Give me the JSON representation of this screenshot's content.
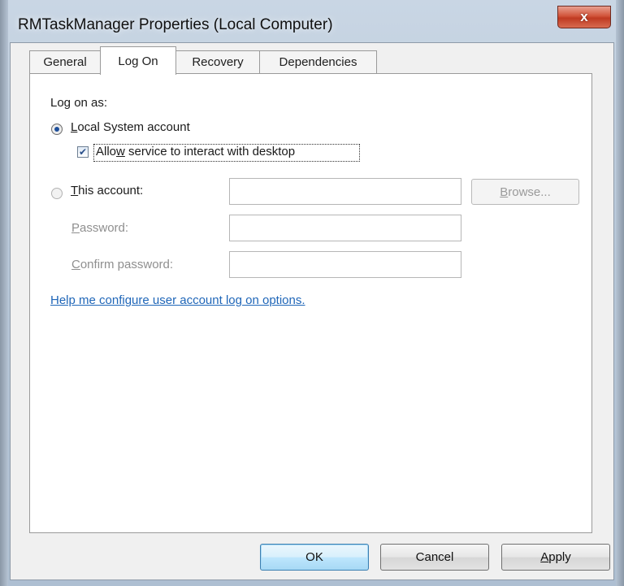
{
  "window": {
    "title": "RMTaskManager Properties (Local Computer)",
    "close_glyph": "x"
  },
  "tabs": [
    {
      "label": "General",
      "active": false
    },
    {
      "label": "Log On",
      "active": true
    },
    {
      "label": "Recovery",
      "active": false
    },
    {
      "label": "Dependencies",
      "active": false
    }
  ],
  "logon": {
    "section_label": "Log on as:",
    "local_system": {
      "mnemonic": "L",
      "rest": "ocal System account",
      "selected": true
    },
    "interact_desktop": {
      "mnemonic": "w",
      "pre": "Allo",
      "rest": " service to interact with desktop",
      "checked": true
    },
    "this_account": {
      "mnemonic": "T",
      "rest": "his account:",
      "selected": false,
      "value": ""
    },
    "browse": {
      "mnemonic": "B",
      "rest": "rowse..."
    },
    "password": {
      "mnemonic": "P",
      "rest": "assword:",
      "value": ""
    },
    "confirm_password": {
      "mnemonic": "C",
      "rest": "onfirm password:",
      "value": ""
    },
    "help_link": "Help me configure user account log on options."
  },
  "buttons": {
    "ok": "OK",
    "cancel": "Cancel",
    "apply_mnemonic": "A",
    "apply_rest": "pply"
  },
  "colors": {
    "link": "#1f66b8",
    "close_button": "#c4432b",
    "disabled_text": "#8f8f8f"
  }
}
